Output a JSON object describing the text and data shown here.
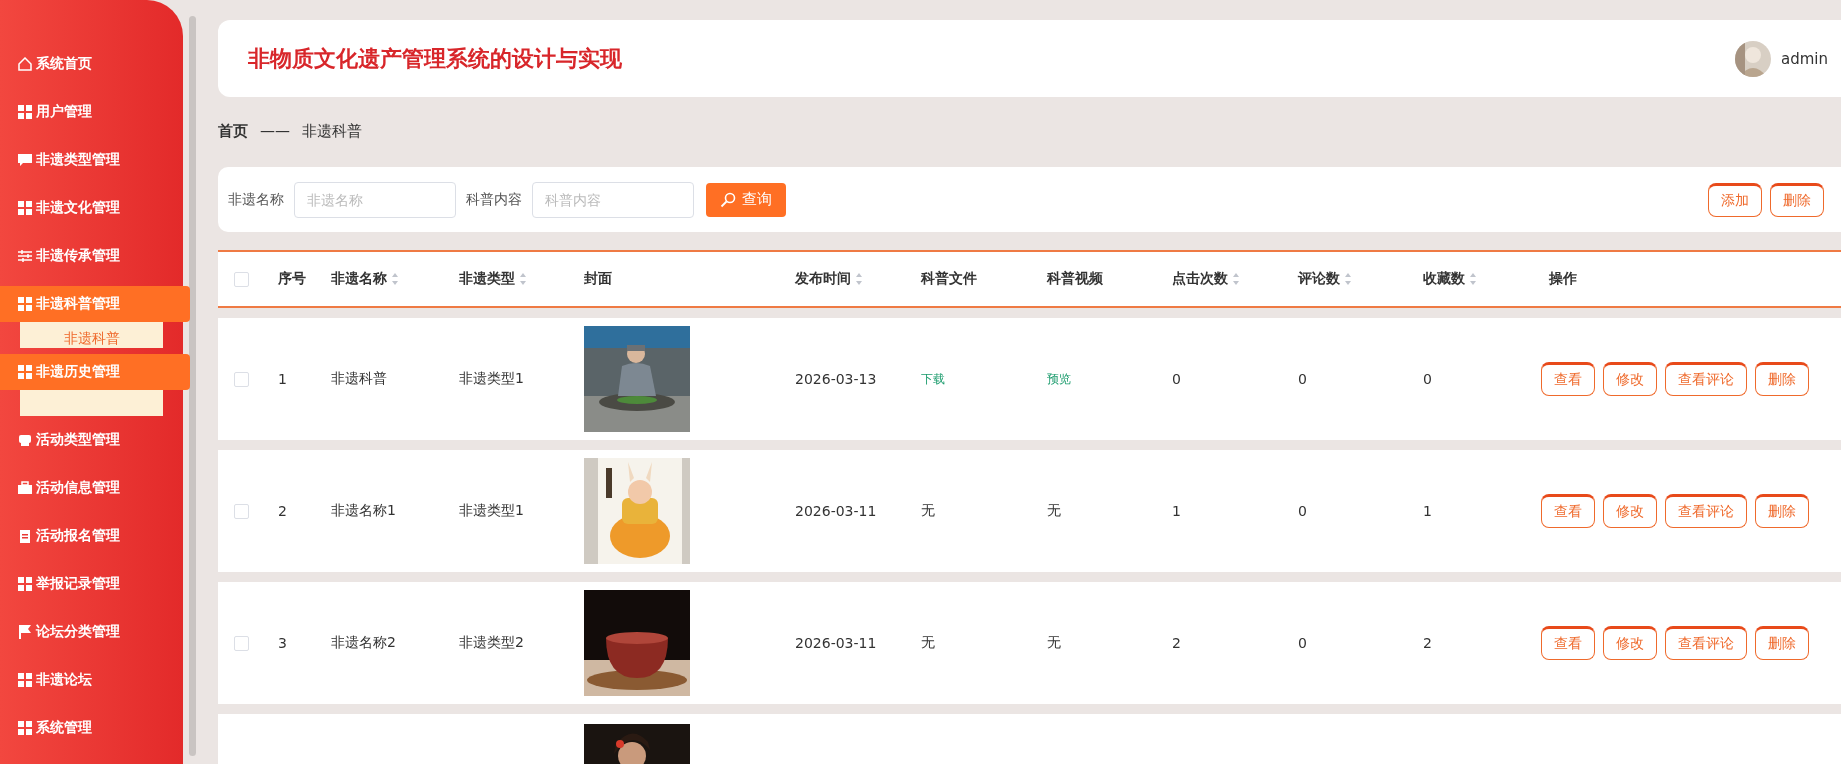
{
  "sidebar": {
    "items": [
      {
        "label": "系统首页",
        "selected": false,
        "expanded": false
      },
      {
        "label": "用户管理",
        "selected": false,
        "expanded": false
      },
      {
        "label": "非遗类型管理",
        "selected": false,
        "expanded": false
      },
      {
        "label": "非遗文化管理",
        "selected": false,
        "expanded": false
      },
      {
        "label": "非遗传承管理",
        "selected": false,
        "expanded": false
      },
      {
        "label": "非遗科普管理",
        "selected": true,
        "expanded": true,
        "children": [
          {
            "label": "非遗科普"
          }
        ]
      },
      {
        "label": "非遗历史管理",
        "selected": true,
        "expanded": true
      },
      {
        "label": "活动类型管理",
        "selected": false,
        "expanded": false
      },
      {
        "label": "活动信息管理",
        "selected": false,
        "expanded": false
      },
      {
        "label": "活动报名管理",
        "selected": false,
        "expanded": false
      },
      {
        "label": "举报记录管理",
        "selected": false,
        "expanded": false
      },
      {
        "label": "论坛分类管理",
        "selected": false,
        "expanded": false
      },
      {
        "label": "非遗论坛",
        "selected": false,
        "expanded": false
      },
      {
        "label": "系统管理",
        "selected": false,
        "expanded": false
      }
    ]
  },
  "header": {
    "title": "非物质文化遗产管理系统的设计与实现",
    "user": "admin"
  },
  "breadcrumb": {
    "home": "首页",
    "separator": "——",
    "current": "非遗科普"
  },
  "search": {
    "fields": [
      {
        "label": "非遗名称",
        "placeholder": "非遗名称"
      },
      {
        "label": "科普内容",
        "placeholder": "科普内容"
      }
    ],
    "button": "查询",
    "actions": [
      "添加",
      "删除"
    ]
  },
  "table": {
    "select_all": {
      "checked": false
    },
    "columns": [
      {
        "label": "序号",
        "sortable": false
      },
      {
        "label": "非遗名称",
        "sortable": true
      },
      {
        "label": "非遗类型",
        "sortable": true
      },
      {
        "label": "封面",
        "sortable": false
      },
      {
        "label": "发布时间",
        "sortable": true
      },
      {
        "label": "科普文件",
        "sortable": false
      },
      {
        "label": "科普视频",
        "sortable": false
      },
      {
        "label": "点击次数",
        "sortable": true
      },
      {
        "label": "评论数",
        "sortable": true
      },
      {
        "label": "收藏数",
        "sortable": true
      },
      {
        "label": "操作",
        "sortable": false
      }
    ],
    "rows": [
      {
        "kind": "full",
        "checked": false,
        "cells": [
          "1",
          "非遗科普",
          "非遗类型1"
        ],
        "cover": {
          "kind": "picture"
        },
        "date": "2026-03-13",
        "file": {
          "kind": "link",
          "text": "下载"
        },
        "video": {
          "kind": "link",
          "text": "预览"
        },
        "counts": [
          "0",
          "0",
          "0"
        ],
        "actions": [
          "查看",
          "修改",
          "查看评论",
          "删除"
        ]
      },
      {
        "kind": "full",
        "checked": false,
        "cells": [
          "2",
          "非遗名称1",
          "非遗类型1"
        ],
        "cover": {
          "kind": "picture"
        },
        "date": "2026-03-11",
        "file": {
          "kind": "text",
          "text": "无"
        },
        "video": {
          "kind": "text",
          "text": "无"
        },
        "counts": [
          "1",
          "0",
          "1"
        ],
        "actions": [
          "查看",
          "修改",
          "查看评论",
          "删除"
        ]
      },
      {
        "kind": "full",
        "checked": false,
        "cells": [
          "3",
          "非遗名称2",
          "非遗类型2"
        ],
        "cover": {
          "kind": "picture"
        },
        "date": "2026-03-11",
        "file": {
          "kind": "text",
          "text": "无"
        },
        "video": {
          "kind": "text",
          "text": "无"
        },
        "counts": [
          "2",
          "0",
          "2"
        ],
        "actions": [
          "查看",
          "修改",
          "查看评论",
          "删除"
        ]
      },
      {
        "kind": "partial",
        "cover": {
          "kind": "picture"
        }
      }
    ]
  }
}
